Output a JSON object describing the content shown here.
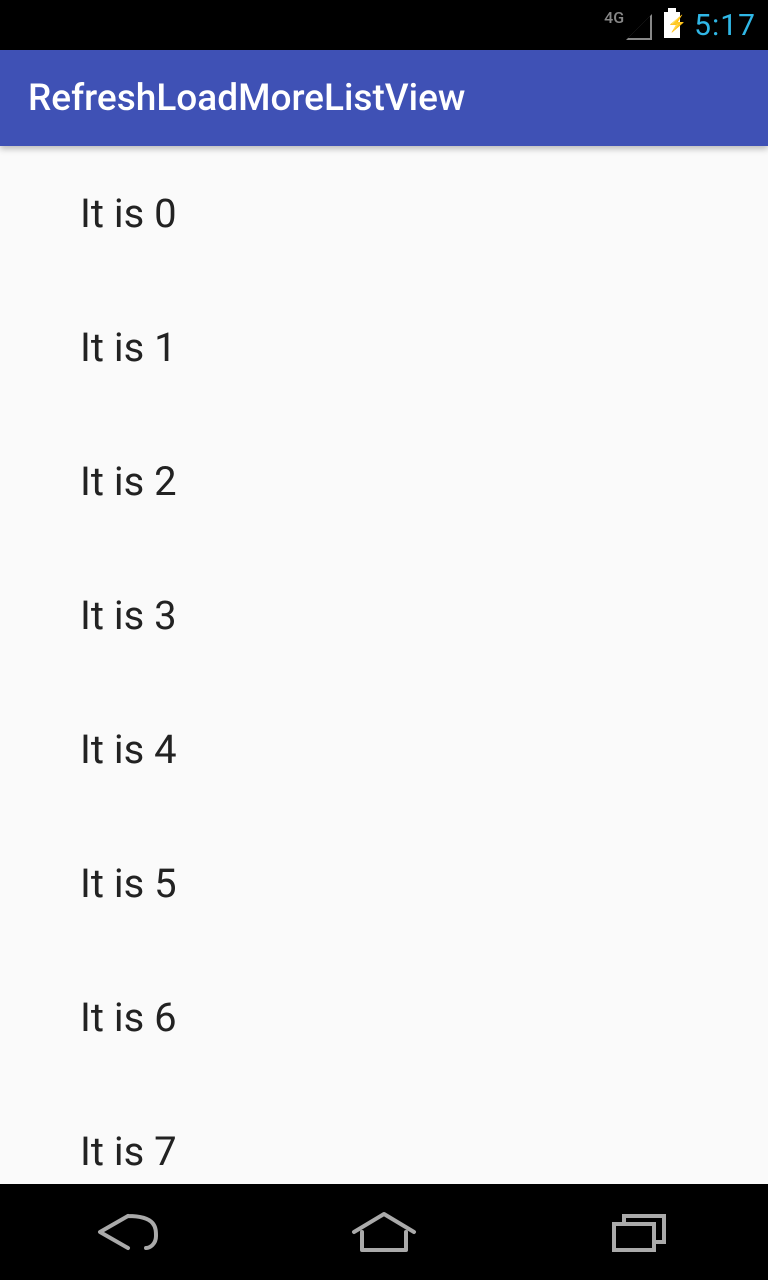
{
  "status_bar": {
    "network_label": "4G",
    "clock": "5:17"
  },
  "action_bar": {
    "title": "RefreshLoadMoreListView"
  },
  "list": {
    "items": [
      {
        "label": "It is 0"
      },
      {
        "label": "It is 1"
      },
      {
        "label": "It is 2"
      },
      {
        "label": "It is 3"
      },
      {
        "label": "It is 4"
      },
      {
        "label": "It is 5"
      },
      {
        "label": "It is 6"
      },
      {
        "label": "It is 7"
      }
    ]
  }
}
